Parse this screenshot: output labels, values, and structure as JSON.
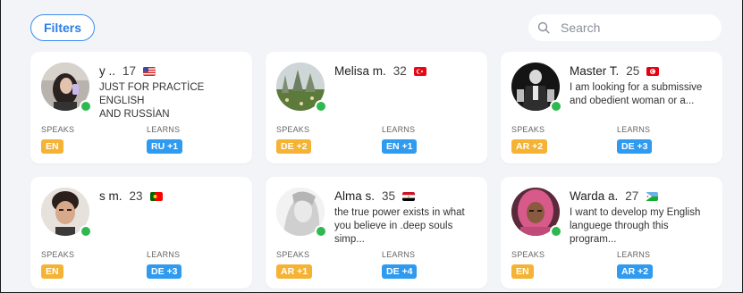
{
  "toolbar": {
    "filters_label": "Filters",
    "search_placeholder": "Search",
    "search_icon": "search-icon"
  },
  "labels": {
    "speaks": "SPEAKS",
    "learns": "LEARNS"
  },
  "colors": {
    "accent": "#2f9bf0",
    "speaks_tag": "#f5b335",
    "learns_tag": "#2f9bf0",
    "online": "#2fb84f"
  },
  "cards": [
    {
      "name": "y ..",
      "age": "17",
      "flag": "flag-us-icon",
      "bio_line1": "JUST FOR PRACTİCE ENGLISH",
      "bio_line2": "AND RUSSİAN",
      "speaks": "EN",
      "learns": "RU +1"
    },
    {
      "name": "Melisa m.",
      "age": "32",
      "flag": "flag-tr-icon",
      "bio_line1": "",
      "bio_line2": "",
      "speaks": "DE +2",
      "learns": "EN +1"
    },
    {
      "name": "Master T.",
      "age": "25",
      "flag": "flag-tn-icon",
      "bio_line1": "I am looking for a submissive",
      "bio_line2": "and obedient woman or a...",
      "speaks": "AR +2",
      "learns": "DE +3"
    },
    {
      "name": "s m.",
      "age": "23",
      "flag": "flag-pt-icon",
      "bio_line1": "",
      "bio_line2": "",
      "speaks": "EN",
      "learns": "DE +3"
    },
    {
      "name": "Alma s.",
      "age": "35",
      "flag": "flag-eg-icon",
      "bio_line1": "the true power exists in what",
      "bio_line2": "you believe in .deep souls simp...",
      "speaks": "AR +1",
      "learns": "DE +4"
    },
    {
      "name": "Warda a.",
      "age": "27",
      "flag": "flag-dj-icon",
      "bio_line1": "I want to develop my English",
      "bio_line2": "languege through this program...",
      "speaks": "EN",
      "learns": "AR +2"
    }
  ]
}
